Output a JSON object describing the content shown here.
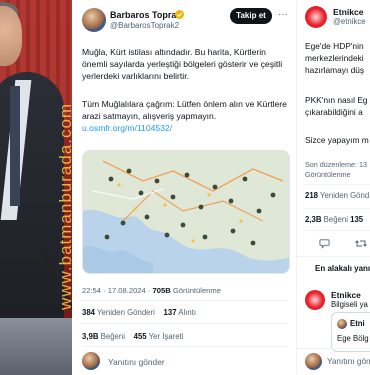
{
  "watermark": "www.batmanburada.com",
  "tweet": {
    "author_name": "Barbaros Toprak",
    "author_handle": "@BarbarosToprak2",
    "follow_label": "Takip et",
    "text1": "Muğla, Kürt istilası altındadır. Bu harita, Kürtlerin önemli sayılarda yerleştiği bölgeleri gösterir ve çeşitli yerlerdeki varlıklarını belirtir.",
    "text2": "Tüm Muğlalılara çağrım: Lütfen önlem alın ve Kürtlere arazi satmayın, alışveriş yapmayın.",
    "link": "u.osmfr.org/m/1104532/",
    "time": "22:54 · 17.08.2024 ·",
    "views": "705B",
    "views_label": "Görüntülenme",
    "retweets": "384",
    "retweets_label": "Yeniden Gönderi",
    "quotes": "137",
    "quotes_label": "Alıntı",
    "likes": "3,9B",
    "likes_label": "Beğeni",
    "bookmarks": "455",
    "bookmarks_label": "Yer İşareti",
    "reply_placeholder": "Yanıtını gönder"
  },
  "right": {
    "author_name": "Etnikce",
    "author_handle": "@etnikce",
    "lines": [
      "Ege'de HDP'nin",
      "merkezlerindeki",
      "hazırlamayı düş",
      "PKK'nın nasıl Eg",
      "çıkarabildiğini a",
      "Sizce yapayım m"
    ],
    "meta1": "Son düzenleme: 13",
    "meta2": "Görüntülenme",
    "retweets": "218",
    "retweets_label": "Yeniden Gönd",
    "likes": "2,3B",
    "likes_label": "Beğeni",
    "likes_extra": "135",
    "relevant_label": "En alakalı yanı",
    "reply_name": "Etnikce",
    "reply_sub": "Bilgiseli ya",
    "quote_name": "Etni",
    "quote_text": "Ege Bölg",
    "reply_placeholder": "Yanıtını gönder"
  },
  "colors": {
    "link": "#1d9bf0",
    "verified": "#f4b400",
    "follow_bg": "#0f1419",
    "watermark": "#f3c34a"
  }
}
